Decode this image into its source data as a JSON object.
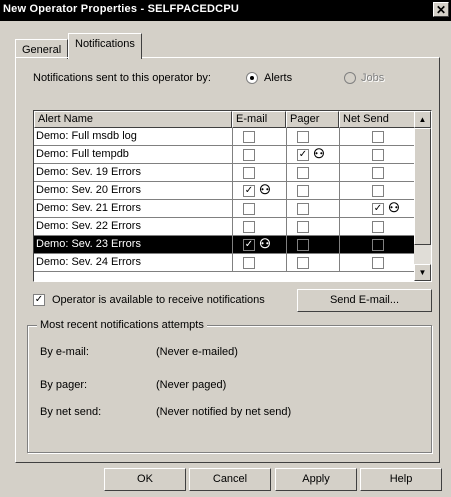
{
  "window": {
    "title": "New Operator Properties - SELFPACEDCPU",
    "close_symbol": "✕"
  },
  "tabs": [
    {
      "label": "General"
    },
    {
      "label": "Notifications"
    }
  ],
  "notify_by": {
    "label": "Notifications sent to this operator by:",
    "alerts_label": "Alerts",
    "jobs_label": "Jobs",
    "selected": "Alerts"
  },
  "grid": {
    "columns": [
      "Alert Name",
      "E-mail",
      "Pager",
      "Net Send"
    ],
    "rows": [
      {
        "name": "Demo: Full msdb log",
        "email": false,
        "pager": false,
        "netsend": false
      },
      {
        "name": "Demo: Full tempdb",
        "email": false,
        "pager": true,
        "netsend": false
      },
      {
        "name": "Demo: Sev. 19 Errors",
        "email": false,
        "pager": false,
        "netsend": false
      },
      {
        "name": "Demo: Sev. 20 Errors",
        "email": true,
        "pager": false,
        "netsend": false
      },
      {
        "name": "Demo: Sev. 21 Errors",
        "email": false,
        "pager": false,
        "netsend": true
      },
      {
        "name": "Demo: Sev. 22 Errors",
        "email": false,
        "pager": false,
        "netsend": false
      },
      {
        "name": "Demo: Sev. 23 Errors",
        "email": true,
        "pager": false,
        "netsend": false,
        "selected": true
      },
      {
        "name": "Demo: Sev. 24 Errors",
        "email": false,
        "pager": false,
        "netsend": false
      }
    ],
    "check_glyph": "✓",
    "operator_glyph": "⚇"
  },
  "available": {
    "label": "Operator is available to receive notifications",
    "checked": true,
    "check_glyph": "✓"
  },
  "send_email_button": "Send E-mail...",
  "recent": {
    "title": "Most recent notifications attempts",
    "items": [
      {
        "label": "By e-mail:",
        "value": "(Never e-mailed)"
      },
      {
        "label": "By pager:",
        "value": "(Never paged)"
      },
      {
        "label": "By net send:",
        "value": "(Never notified by net send)"
      }
    ]
  },
  "buttons": {
    "ok": "OK",
    "cancel": "Cancel",
    "apply": "Apply",
    "help": "Help"
  },
  "scroll": {
    "up_glyph": "▲",
    "down_glyph": "▼"
  }
}
